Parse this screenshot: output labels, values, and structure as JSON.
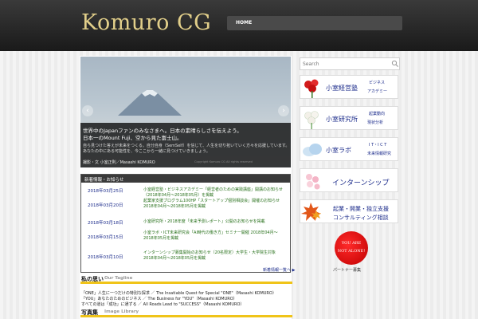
{
  "header": {
    "logo": "Komuro CG",
    "nav": {
      "home": "HOME"
    }
  },
  "slider": {
    "title_line1": "世界中のJapanファンのみなさまへ。日本の素晴らしさを伝えよう。",
    "title_line2": "日本一のMount Fuji、空から見た富士山。",
    "desc_line1": "自ら見つけた答えが未来をつくる。自分自身（SemSelf）を信じて、人生を切り拓いていく方々を応援しています。",
    "desc_line2": "あなたの中にある可能性を、今ここから一緒に見つけていきましょう。",
    "author": "撮影・文 小室正則／Masashi KOMURO",
    "copyright": "Copyright Komuro CG All rights reserved",
    "prev_arrow": "‹",
    "next_arrow": "›"
  },
  "news": {
    "header": "新着情報・お知らせ",
    "items": [
      {
        "date": "2018年03月25日",
        "text": "小室経営塾・ビジネスアカデミー「経営者のための実践講座」開講のお知らせ（2018年04月～2018年05月）を掲載"
      },
      {
        "date": "2018年03月20日",
        "text": "起業家支援プログラム100HP「スタートアップ個別相談会」開催のお知らせ 2018年04月～2018年05月を掲載"
      },
      {
        "date": "2018年03月18日",
        "text": "小室研究所・2018年度「未来予測レポート」公開のお知らせを掲載"
      },
      {
        "date": "2018年03月15日",
        "text": "小室ラボ・ICT未来研究会「AI時代の働き方」セミナー開催 2018年04月～2018年05月を掲載"
      },
      {
        "date": "2018年03月10日",
        "text": "インターンシップ募集開始のお知らせ（20名限定）大学生・大学院生対象 2018年04月～2018年05月を掲載"
      }
    ],
    "more": "新着情報一覧へ ▶"
  },
  "tagline": {
    "title": "私の思い",
    "subtitle": "Our Tagline",
    "lines": [
      "「ONE」人生に一つだけの特別な探求 ／ The Insatiable Quest for Special \"ONE\"（Masashi KOMURO）",
      "「YOU」あなたのためのビジネス ／ The Business for \"YOU\"（Masashi KOMURO）",
      "すべての道は「成功」に通ずる ／ All Roads Lead to \"SUCCESS\"（Masashi KOMURO）"
    ]
  },
  "gallery": {
    "title": "写真集",
    "subtitle": "Image Library"
  },
  "sidebar": {
    "search_placeholder": "Search",
    "banners": [
      {
        "main": "小室経営塾",
        "sub1": "ビジネス",
        "sub2": "アカデミー"
      },
      {
        "main": "小室研究所",
        "sub1": "起業動向",
        "sub2": "現状分析"
      },
      {
        "main": "小室ラボ",
        "sub1": "I T・I C T",
        "sub2": "未来情報研究"
      },
      {
        "main": "インターンシップ"
      },
      {
        "line1": "起業・開業・独立支援",
        "line2": "コンサルティング相談"
      }
    ],
    "badge": {
      "line1": "YOU ARE",
      "line2": "NOT ALONE!"
    },
    "partner": "パートナー募集"
  },
  "colors": {
    "header_bg": "#2a2a2a",
    "logo": "#e2cf8a",
    "link_blue": "#1a2a8a",
    "news_green": "#27701a",
    "accent_yellow": "#f0c419"
  }
}
